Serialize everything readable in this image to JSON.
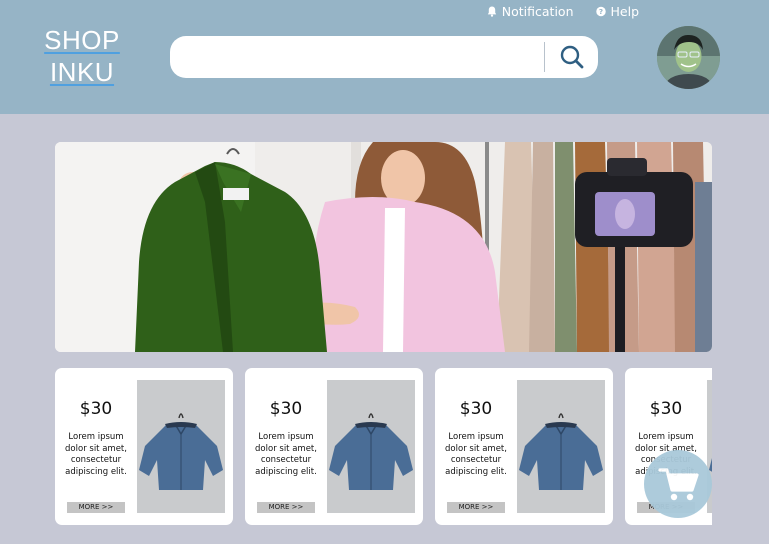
{
  "header": {
    "logo_line1": "SHOP",
    "logo_line2": "INKU",
    "notification_label": "Notification",
    "help_label": "Help",
    "search_placeholder": ""
  },
  "banner": {
    "alt": "Woman holding a green blazer next to a clothing rack in front of a camera"
  },
  "products": [
    {
      "price": "$30",
      "description": "Lorem ipsum dolor sit amet, consectetur adipiscing elit.",
      "more_label": "MORE >>"
    },
    {
      "price": "$30",
      "description": "Lorem ipsum dolor sit amet, consectetur adipiscing elit.",
      "more_label": "MORE >>"
    },
    {
      "price": "$30",
      "description": "Lorem ipsum dolor sit amet, consectetur adipiscing elit.",
      "more_label": "MORE >>"
    },
    {
      "price": "$30",
      "description": "Lorem ipsum dolor sit amet, consectetur adipiscing elit.",
      "more_label": "MORE >>"
    }
  ],
  "colors": {
    "header_bg": "#96b4c6",
    "page_bg": "#c6c8d5",
    "cart_button": "#a9c9da"
  },
  "icons": [
    "bell-icon",
    "help-icon",
    "search-icon",
    "avatar",
    "cart-icon",
    "shirt-icon"
  ]
}
